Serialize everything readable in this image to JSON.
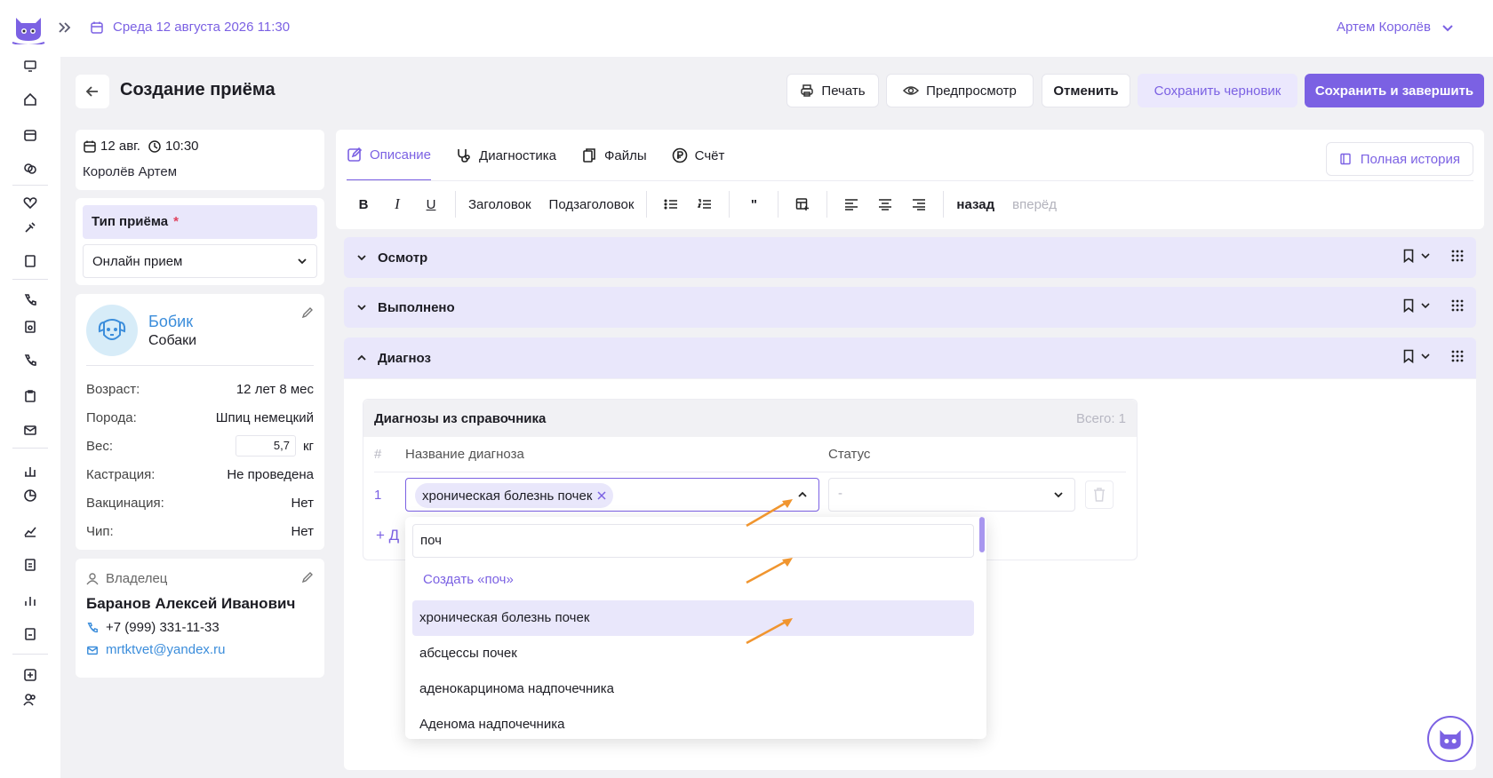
{
  "topbar": {
    "date_text": "Среда 12 августа 2026 11:30",
    "user_name": "Артем Королёв"
  },
  "header": {
    "title": "Создание приёма",
    "print_label": "Печать",
    "preview_label": "Предпросмотр",
    "cancel_label": "Отменить",
    "save_draft_label": "Сохранить черновик",
    "save_finish_label": "Сохранить и завершить"
  },
  "visit": {
    "date": "12 авг.",
    "time": "10:30",
    "doctor": "Королёв Артем"
  },
  "visit_type": {
    "label": "Тип приёма",
    "required_mark": "*",
    "value": "Онлайн прием"
  },
  "pet": {
    "name": "Бобик",
    "species": "Собаки",
    "attributes": [
      {
        "key": "Возраст:",
        "value": "12 лет 8 мес"
      },
      {
        "key": "Порода:",
        "value": "Шпиц немецкий"
      },
      {
        "key": "Вес:",
        "value": "5,7",
        "unit": "кг"
      },
      {
        "key": "Кастрация:",
        "value": "Не проведена"
      },
      {
        "key": "Вакцинация:",
        "value": "Нет"
      },
      {
        "key": "Чип:",
        "value": "Нет"
      }
    ]
  },
  "owner": {
    "header": "Владелец",
    "name": "Баранов Алексей Иванович",
    "phone": "+7 (999) 331-11-33",
    "email": "mrtktvet@yandex.ru"
  },
  "editor": {
    "tabs": [
      "Описание",
      "Диагностика",
      "Файлы",
      "Счёт"
    ],
    "history_label": "Полная история",
    "toolbar": {
      "bold": "B",
      "italic": "I",
      "underline": "U",
      "heading": "Заголовок",
      "subheading": "Подзаголовок",
      "quote": "\"",
      "undo": "назад",
      "redo": "вперёд"
    }
  },
  "sections": [
    {
      "title": "Осмотр",
      "expanded": false
    },
    {
      "title": "Выполнено",
      "expanded": false
    },
    {
      "title": "Диагноз",
      "expanded": true
    }
  ],
  "diagnoses": {
    "title": "Диагнозы из справочника",
    "total": "Всего: 1",
    "col_num": "#",
    "col_name": "Название диагноза",
    "col_status": "Статус",
    "row_num": "1",
    "selected": "хроническая болезнь почек",
    "status_placeholder": "-",
    "add_prefix": "+ Д"
  },
  "dropdown": {
    "search_value": "поч",
    "create_label": "Создать «поч»",
    "options": [
      "хроническая болезнь почек",
      "абсцессы почек",
      "аденокарцинома надпочечника",
      "Аденома надпочечника"
    ],
    "highlighted_index": 0
  },
  "colors": {
    "accent": "#7b61e3",
    "accent_light": "#e9e7fb",
    "link": "#3b8ddb",
    "arrow": "#f0952f"
  }
}
